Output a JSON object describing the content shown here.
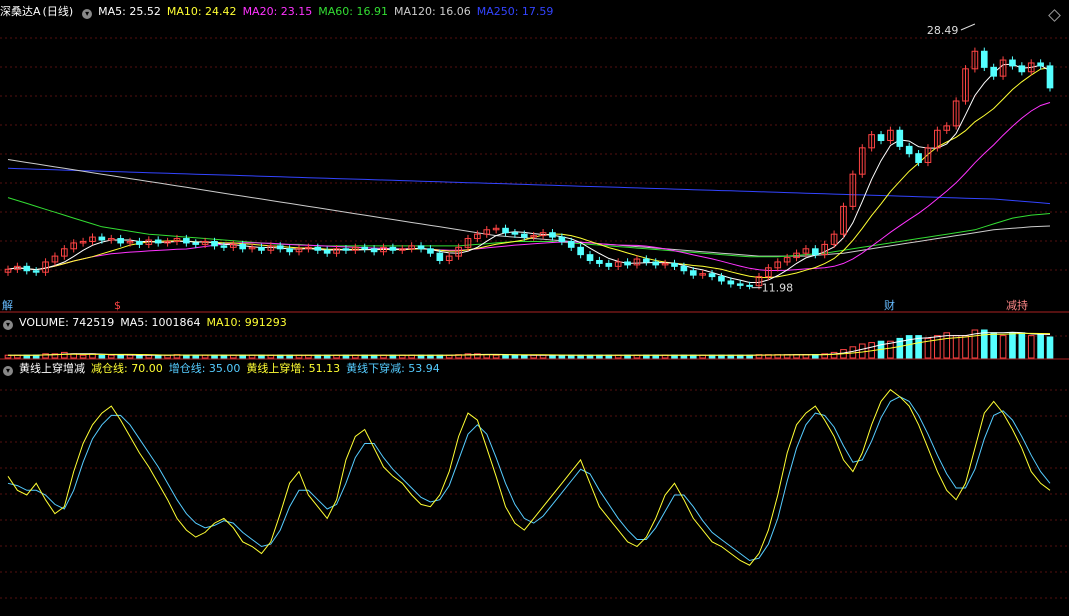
{
  "stock": {
    "name": "深桑达A",
    "period": "(日线)"
  },
  "price_panel": {
    "ma_legend": [
      {
        "label": "MA5: 25.52",
        "color": "#ffffff"
      },
      {
        "label": "MA10: 24.42",
        "color": "#ffff33"
      },
      {
        "label": "MA20: 23.15",
        "color": "#ff33ff"
      },
      {
        "label": "MA60: 16.91",
        "color": "#33dd33"
      },
      {
        "label": "MA120: 16.06",
        "color": "#cccccc"
      },
      {
        "label": "MA250: 17.59",
        "color": "#3344ff"
      }
    ],
    "high_label": "28.49",
    "low_label": "11.98",
    "markers": [
      {
        "text": "解",
        "color": "#66bbff"
      },
      {
        "text": "$",
        "color": "#ff4444"
      },
      {
        "text": "财",
        "color": "#66bbff"
      },
      {
        "text": "减持",
        "color": "#ff8888"
      }
    ]
  },
  "volume_panel": {
    "legend": [
      {
        "label": "VOLUME: 742519",
        "color": "#ffffff"
      },
      {
        "label": "MA5: 1001864",
        "color": "#ffffff"
      },
      {
        "label": "MA10: 991293",
        "color": "#ffff33"
      }
    ]
  },
  "indicator_panel": {
    "title": "黄线上穿增减",
    "legend": [
      {
        "label": "减仓线: 70.00",
        "color": "#ffff33"
      },
      {
        "label": "增仓线: 35.00",
        "color": "#55ccff"
      },
      {
        "label": "黄线上穿增: 51.13",
        "color": "#ffff33"
      },
      {
        "label": "黄线下穿减: 53.94",
        "color": "#55ccff"
      }
    ]
  },
  "chart_data": {
    "type": "candlestick",
    "ylim": [
      11,
      30
    ],
    "ma_colors": {
      "ma5": "#ffffff",
      "ma10": "#ffff33",
      "ma20": "#ff33ff",
      "ma60": "#33dd33",
      "ma120": "#cccccc",
      "ma250": "#3344ff"
    },
    "up_color": "#ff4444",
    "down_color": "#55ffff",
    "close": [
      13.1,
      13.3,
      13.0,
      12.9,
      13.6,
      14.0,
      14.5,
      14.9,
      15.0,
      15.3,
      15.1,
      15.2,
      14.9,
      15.0,
      14.8,
      15.1,
      14.9,
      15.0,
      15.2,
      14.9,
      14.8,
      15.0,
      14.7,
      14.6,
      14.8,
      14.5,
      14.6,
      14.4,
      14.7,
      14.5,
      14.3,
      14.5,
      14.6,
      14.4,
      14.2,
      14.5,
      14.4,
      14.6,
      14.5,
      14.3,
      14.6,
      14.4,
      14.5,
      14.7,
      14.5,
      14.2,
      13.7,
      14.0,
      14.6,
      15.2,
      15.5,
      15.8,
      15.9,
      15.6,
      15.5,
      15.3,
      15.4,
      15.6,
      15.3,
      15.0,
      14.6,
      14.1,
      13.7,
      13.5,
      13.3,
      13.6,
      13.4,
      13.8,
      13.6,
      13.4,
      13.5,
      13.3,
      13.0,
      12.7,
      12.8,
      12.6,
      12.3,
      12.1,
      12.0,
      11.98,
      12.6,
      13.2,
      13.6,
      13.9,
      14.2,
      14.5,
      14.1,
      14.8,
      15.5,
      17.4,
      19.6,
      21.4,
      22.3,
      21.9,
      22.6,
      21.5,
      21.0,
      20.4,
      21.4,
      22.6,
      22.9,
      24.6,
      26.8,
      28.0,
      26.9,
      26.3,
      27.4,
      27.0,
      26.6,
      27.2,
      27.0,
      25.5
    ],
    "ma250": [
      20.0,
      19.98,
      19.96,
      19.94,
      19.92,
      19.9,
      19.88,
      19.86,
      19.84,
      19.82,
      19.8,
      19.78,
      19.76,
      19.74,
      19.72,
      19.7,
      19.68,
      19.66,
      19.64,
      19.62,
      19.6,
      19.58,
      19.56,
      19.54,
      19.52,
      19.5,
      19.48,
      19.46,
      19.44,
      19.42,
      19.4,
      19.38,
      19.36,
      19.34,
      19.32,
      19.3,
      19.28,
      19.26,
      19.24,
      19.22,
      19.2,
      19.18,
      19.16,
      19.14,
      19.12,
      19.1,
      19.08,
      19.06,
      19.04,
      19.02,
      19.0,
      18.98,
      18.96,
      18.94,
      18.92,
      18.9,
      18.88,
      18.86,
      18.84,
      18.82,
      18.8,
      18.78,
      18.76,
      18.74,
      18.72,
      18.7,
      18.68,
      18.66,
      18.64,
      18.62,
      18.6,
      18.58,
      18.56,
      18.54,
      18.52,
      18.5,
      18.48,
      18.46,
      18.44,
      18.42,
      18.4,
      18.38,
      18.36,
      18.34,
      18.32,
      18.3,
      18.28,
      18.26,
      18.24,
      18.22,
      18.2,
      18.18,
      18.16,
      18.14,
      18.12,
      18.1,
      18.08,
      18.06,
      18.04,
      18.02,
      18.0,
      17.98,
      17.96,
      17.94,
      17.92,
      17.9,
      17.85,
      17.8,
      17.75,
      17.7,
      17.65,
      17.59
    ],
    "ma120": [
      20.6,
      20.5,
      20.4,
      20.3,
      20.2,
      20.1,
      20.0,
      19.9,
      19.8,
      19.7,
      19.6,
      19.5,
      19.4,
      19.3,
      19.2,
      19.1,
      19.0,
      18.9,
      18.8,
      18.7,
      18.6,
      18.5,
      18.4,
      18.3,
      18.2,
      18.1,
      18.0,
      17.9,
      17.8,
      17.7,
      17.6,
      17.5,
      17.4,
      17.3,
      17.2,
      17.1,
      17.0,
      16.9,
      16.8,
      16.7,
      16.6,
      16.5,
      16.4,
      16.3,
      16.2,
      16.1,
      16.0,
      15.9,
      15.8,
      15.7,
      15.6,
      15.5,
      15.4,
      15.35,
      15.3,
      15.25,
      15.2,
      15.15,
      15.1,
      15.05,
      15.0,
      14.95,
      14.9,
      14.85,
      14.8,
      14.75,
      14.7,
      14.65,
      14.6,
      14.55,
      14.5,
      14.45,
      14.4,
      14.35,
      14.3,
      14.25,
      14.2,
      14.15,
      14.1,
      14.05,
      14.0,
      14.0,
      14.0,
      14.0,
      14.0,
      14.0,
      14.05,
      14.1,
      14.15,
      14.2,
      14.3,
      14.4,
      14.5,
      14.6,
      14.7,
      14.8,
      14.9,
      15.0,
      15.1,
      15.2,
      15.3,
      15.4,
      15.5,
      15.6,
      15.7,
      15.8,
      15.85,
      15.9,
      15.95,
      16.0,
      16.03,
      16.06
    ],
    "ma60": [
      18.0,
      17.8,
      17.6,
      17.4,
      17.2,
      17.0,
      16.8,
      16.6,
      16.4,
      16.2,
      16.0,
      15.9,
      15.8,
      15.7,
      15.6,
      15.5,
      15.45,
      15.4,
      15.35,
      15.3,
      15.25,
      15.2,
      15.15,
      15.1,
      15.05,
      15.0,
      14.95,
      14.9,
      14.85,
      14.8,
      14.8,
      14.8,
      14.75,
      14.7,
      14.7,
      14.7,
      14.7,
      14.7,
      14.7,
      14.7,
      14.7,
      14.7,
      14.7,
      14.7,
      14.7,
      14.7,
      14.7,
      14.7,
      14.7,
      14.75,
      14.8,
      14.85,
      14.9,
      14.95,
      15.0,
      15.0,
      15.0,
      15.0,
      15.0,
      14.95,
      14.9,
      14.85,
      14.8,
      14.75,
      14.7,
      14.65,
      14.6,
      14.55,
      14.5,
      14.45,
      14.4,
      14.35,
      14.3,
      14.25,
      14.2,
      14.15,
      14.1,
      14.05,
      14.0,
      13.95,
      13.95,
      13.95,
      13.95,
      14.0,
      14.05,
      14.1,
      14.15,
      14.2,
      14.3,
      14.4,
      14.5,
      14.6,
      14.7,
      14.8,
      14.9,
      15.0,
      15.1,
      15.2,
      15.3,
      15.4,
      15.5,
      15.6,
      15.7,
      15.8,
      16.0,
      16.2,
      16.4,
      16.6,
      16.7,
      16.8,
      16.85,
      16.91
    ],
    "volume": [
      0.1,
      0.1,
      0.1,
      0.1,
      0.15,
      0.15,
      0.2,
      0.15,
      0.1,
      0.15,
      0.1,
      0.1,
      0.1,
      0.1,
      0.1,
      0.1,
      0.1,
      0.1,
      0.12,
      0.1,
      0.1,
      0.1,
      0.1,
      0.1,
      0.1,
      0.1,
      0.1,
      0.1,
      0.1,
      0.1,
      0.1,
      0.1,
      0.1,
      0.1,
      0.1,
      0.1,
      0.1,
      0.1,
      0.1,
      0.1,
      0.1,
      0.1,
      0.1,
      0.1,
      0.1,
      0.1,
      0.1,
      0.1,
      0.12,
      0.15,
      0.15,
      0.12,
      0.1,
      0.1,
      0.1,
      0.1,
      0.1,
      0.1,
      0.1,
      0.1,
      0.1,
      0.1,
      0.1,
      0.1,
      0.1,
      0.1,
      0.1,
      0.1,
      0.1,
      0.1,
      0.1,
      0.1,
      0.1,
      0.1,
      0.1,
      0.1,
      0.1,
      0.1,
      0.1,
      0.1,
      0.12,
      0.12,
      0.12,
      0.12,
      0.12,
      0.12,
      0.12,
      0.15,
      0.2,
      0.3,
      0.4,
      0.5,
      0.55,
      0.6,
      0.6,
      0.7,
      0.8,
      0.8,
      0.7,
      0.8,
      0.9,
      0.8,
      0.8,
      1.0,
      1.0,
      0.9,
      0.8,
      0.9,
      0.9,
      0.8,
      0.85,
      0.75
    ],
    "yellow": [
      58,
      52,
      50,
      55,
      48,
      42,
      45,
      60,
      72,
      80,
      85,
      88,
      82,
      75,
      68,
      62,
      55,
      48,
      40,
      35,
      32,
      34,
      38,
      40,
      36,
      30,
      28,
      25,
      30,
      42,
      55,
      60,
      50,
      45,
      40,
      48,
      65,
      75,
      78,
      70,
      62,
      58,
      55,
      50,
      46,
      45,
      50,
      60,
      75,
      85,
      82,
      70,
      58,
      45,
      38,
      35,
      40,
      45,
      50,
      55,
      60,
      65,
      55,
      45,
      40,
      35,
      30,
      28,
      32,
      40,
      50,
      55,
      48,
      40,
      35,
      30,
      28,
      25,
      22,
      20,
      25,
      35,
      50,
      68,
      80,
      85,
      88,
      82,
      75,
      65,
      60,
      68,
      80,
      90,
      95,
      92,
      88,
      80,
      70,
      60,
      52,
      48,
      55,
      70,
      85,
      90,
      85,
      78,
      70,
      60,
      55,
      52
    ],
    "blue": [
      55,
      54,
      52,
      52,
      50,
      46,
      44,
      52,
      64,
      74,
      80,
      84,
      84,
      80,
      74,
      68,
      62,
      55,
      48,
      42,
      38,
      36,
      37,
      39,
      38,
      34,
      31,
      28,
      29,
      35,
      45,
      52,
      52,
      48,
      44,
      46,
      55,
      66,
      72,
      72,
      66,
      61,
      57,
      53,
      49,
      47,
      48,
      54,
      65,
      76,
      80,
      76,
      66,
      55,
      46,
      40,
      38,
      41,
      46,
      51,
      56,
      61,
      59,
      52,
      46,
      40,
      35,
      31,
      31,
      36,
      43,
      50,
      50,
      45,
      39,
      34,
      31,
      28,
      25,
      22,
      23,
      29,
      40,
      56,
      70,
      80,
      85,
      84,
      79,
      71,
      64,
      65,
      73,
      83,
      90,
      92,
      90,
      84,
      76,
      67,
      59,
      53,
      53,
      61,
      74,
      84,
      86,
      82,
      75,
      67,
      60,
      55
    ]
  }
}
